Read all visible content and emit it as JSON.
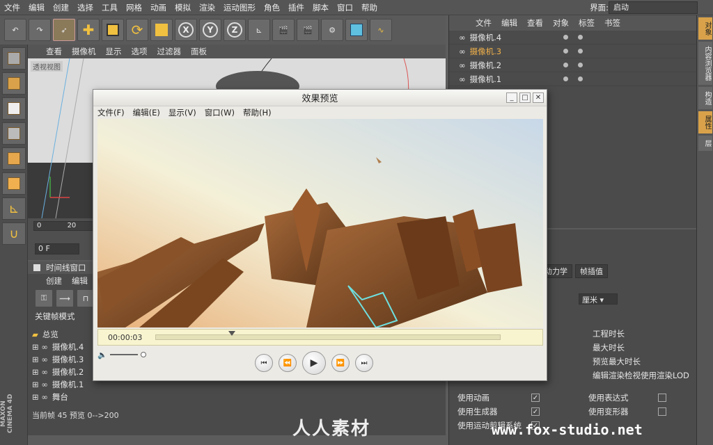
{
  "menubar": {
    "items": [
      "文件",
      "编辑",
      "创建",
      "选择",
      "工具",
      "网格",
      "动画",
      "模拟",
      "渲染",
      "运动图形",
      "角色",
      "插件",
      "脚本",
      "窗口",
      "帮助"
    ],
    "layout_label": "界面:",
    "layout_value": "启动"
  },
  "viewport": {
    "menu": [
      "查看",
      "摄像机",
      "显示",
      "选项",
      "过滤器",
      "面板"
    ],
    "label": "透视视图"
  },
  "timeline": {
    "ruler": [
      "0",
      "20"
    ],
    "frame_field": "0 F",
    "window_title": "时间线窗口",
    "menu": [
      "创建",
      "编辑"
    ],
    "mode_label": "关键帧模式",
    "tree": [
      "总览",
      "摄像机.4",
      "摄像机.3",
      "摄像机.2",
      "摄像机.1",
      "舞台"
    ],
    "status": "当前帧  45  预览  0-->200"
  },
  "object_manager": {
    "menu": [
      "文件",
      "编辑",
      "查看",
      "对象",
      "标签",
      "书签"
    ],
    "rows": [
      {
        "name": "摄像机.4",
        "active": false
      },
      {
        "name": "摄像机.3",
        "active": true
      },
      {
        "name": "摄像机.2",
        "active": false
      },
      {
        "name": "摄像机.1",
        "active": false
      }
    ]
  },
  "side_tabs": [
    "对象",
    "内容浏览器",
    "构造",
    "属性",
    "层"
  ],
  "attributes": {
    "tabs": [
      "动力学",
      "帧插值"
    ],
    "unit": "厘米",
    "labels": [
      "工程时长",
      "最大时长",
      "预览最大时长",
      "编辑渲染检视使用渲染LOD"
    ],
    "checks": [
      {
        "left": "使用动画",
        "right": "使用表达式"
      },
      {
        "left": "使用生成器",
        "right": "使用变形器"
      },
      {
        "left": "使用运动剪辑系统",
        "right": ""
      }
    ]
  },
  "preview": {
    "title": "效果预览",
    "menu": [
      "文件(F)",
      "编辑(E)",
      "显示(V)",
      "窗口(W)",
      "帮助(H)"
    ],
    "time": "00:00:03",
    "progress": 0.21,
    "buttons": [
      "skip-back",
      "rewind",
      "play",
      "fast-forward",
      "skip-forward"
    ]
  },
  "branding": {
    "cinema": "MAXON CINEMA 4D",
    "wm_cn": "人人素材",
    "wm_url": "www.fox-studio.net"
  }
}
